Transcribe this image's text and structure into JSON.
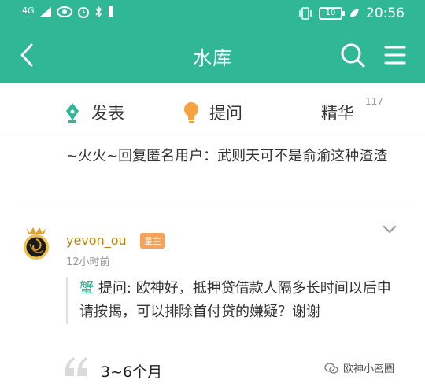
{
  "status_bar": {
    "signal": "4G",
    "battery": "10",
    "time": "20:56"
  },
  "nav": {
    "title": "水库"
  },
  "actions": {
    "post_label": "发表",
    "ask_label": "提问",
    "featured_label": "精华",
    "featured_count": "117"
  },
  "reply": {
    "text": "~火火~回复匿名用户：武则天可不是俞渝这种渣渣"
  },
  "post": {
    "username": "yevon_ou",
    "role_badge": "星主",
    "time": "12小时前",
    "quote_author": "蟹",
    "quote_text": "提问: 欧神好，抵押贷借款人隔多长时间以后申请按揭，可以排除首付贷的嫌疑？谢谢",
    "answer": "3~6个月"
  },
  "watermark": {
    "text": "欧神小密圈"
  },
  "colors": {
    "accent": "#2fb796",
    "username": "#b8860b",
    "badge": "#f3a35a"
  }
}
